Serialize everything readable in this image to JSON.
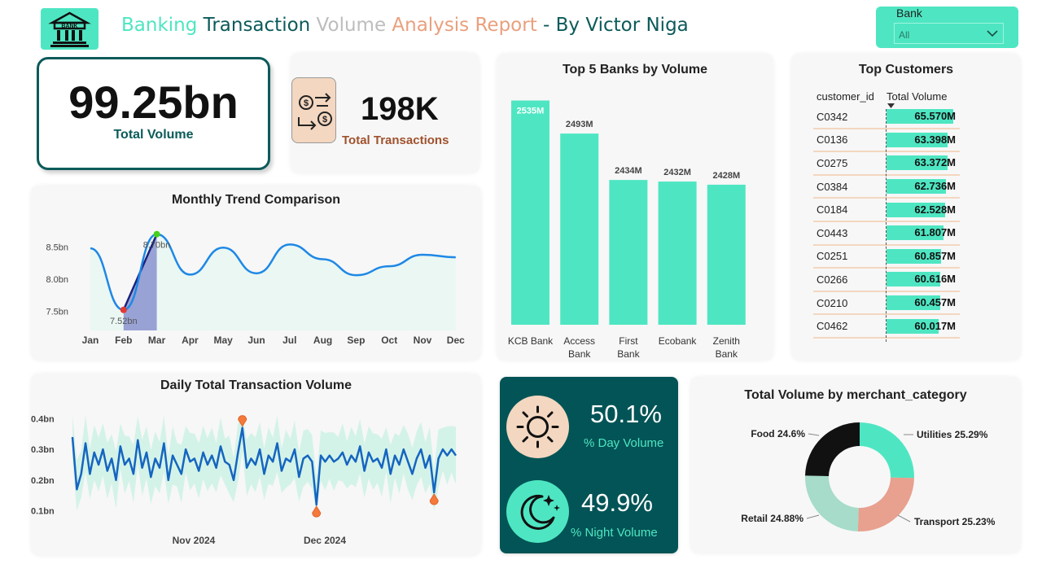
{
  "header": {
    "title_parts": [
      "Banking",
      "Transaction",
      "Volume",
      "Analysis Report",
      "- By Victor Niga"
    ],
    "title_colors": [
      "#4ee6c2",
      "#0c5a5a",
      "#bdbdbd",
      "#e9a07d",
      "#0c5a5a"
    ],
    "logo_text": "BANK"
  },
  "slicer": {
    "label": "Bank",
    "value": "All"
  },
  "kpi": {
    "total_volume": "99.25bn",
    "total_volume_label": "Total Volume",
    "total_transactions": "198K",
    "total_transactions_label": "Total Transactions"
  },
  "monthly": {
    "title": "Monthly Trend Comparison",
    "y_ticks": [
      "8.5bn",
      "8.0bn",
      "7.5bn"
    ],
    "low_label": "7.52bn",
    "high_label": "8.70bn"
  },
  "top5": {
    "title": "Top 5 Banks by Volume"
  },
  "top_customers": {
    "title": "Top Customers",
    "col1": "customer_id",
    "col2": "Total Volume",
    "rows": [
      {
        "id": "C0342",
        "value": "65.570M"
      },
      {
        "id": "C0136",
        "value": "63.398M"
      },
      {
        "id": "C0275",
        "value": "63.372M"
      },
      {
        "id": "C0384",
        "value": "62.736M"
      },
      {
        "id": "C0184",
        "value": "62.528M"
      },
      {
        "id": "C0443",
        "value": "61.807M"
      },
      {
        "id": "C0251",
        "value": "60.857M"
      },
      {
        "id": "C0266",
        "value": "60.616M"
      },
      {
        "id": "C0210",
        "value": "60.457M"
      },
      {
        "id": "C0462",
        "value": "60.017M"
      }
    ]
  },
  "daily": {
    "title": "Daily Total Transaction Volume",
    "y_ticks": [
      "0.4bn",
      "0.3bn",
      "0.2bn",
      "0.1bn"
    ],
    "x_ticks": [
      "Nov 2024",
      "Dec 2024"
    ]
  },
  "day_night": {
    "day_value": "50.1%",
    "day_label": "% Day Volume",
    "night_value": "49.9%",
    "night_label": "% Night Volume"
  },
  "merchant": {
    "title": "Total Volume by merchant_category"
  },
  "colors": {
    "accent": "#4ee6c2",
    "teal_dark": "#035456",
    "peach": "#f3d7c0",
    "salmon": "#e8a08f",
    "mint": "#a6dcc9",
    "line_blue": "#1e88e5"
  },
  "chart_data": [
    {
      "type": "line",
      "title": "Monthly Trend Comparison",
      "categories": [
        "Jan",
        "Feb",
        "Mar",
        "Apr",
        "May",
        "Jun",
        "Jul",
        "Aug",
        "Sep",
        "Oct",
        "Nov",
        "Dec"
      ],
      "values": [
        8.48,
        7.52,
        8.7,
        8.07,
        8.49,
        8.09,
        8.54,
        8.31,
        8.06,
        8.2,
        8.38,
        8.34
      ],
      "yunit": "bn",
      "ylim": [
        7.2,
        8.95
      ],
      "annotations": [
        "7.52bn",
        "8.70bn"
      ]
    },
    {
      "type": "bar",
      "title": "Top 5 Banks by Volume",
      "categories": [
        "KCB Bank",
        "Access Bank",
        "First Bank",
        "Ecobank",
        "Zenith Bank"
      ],
      "values": [
        2535,
        2493,
        2434,
        2432,
        2428
      ],
      "labels": [
        "2535M",
        "2493M",
        "2434M",
        "2432M",
        "2428M"
      ],
      "ylim": [
        2250,
        2550
      ]
    },
    {
      "type": "table",
      "title": "Top Customers",
      "columns": [
        "customer_id",
        "Total Volume"
      ],
      "values": [
        65.57,
        63.398,
        63.372,
        62.736,
        62.528,
        61.807,
        60.857,
        60.616,
        60.457,
        60.017
      ]
    },
    {
      "type": "line",
      "title": "Daily Total Transaction Volume",
      "x_ticks": [
        "Nov 2024",
        "Dec 2024"
      ],
      "yunit": "bn",
      "ylim": [
        0.07,
        0.43
      ],
      "values": [
        0.34,
        0.17,
        0.22,
        0.32,
        0.22,
        0.29,
        0.25,
        0.3,
        0.23,
        0.27,
        0.2,
        0.31,
        0.25,
        0.27,
        0.22,
        0.33,
        0.24,
        0.29,
        0.21,
        0.27,
        0.24,
        0.32,
        0.2,
        0.28,
        0.25,
        0.22,
        0.3,
        0.26,
        0.27,
        0.23,
        0.29,
        0.25,
        0.28,
        0.24,
        0.31,
        0.26,
        0.25,
        0.2,
        0.29,
        0.37,
        0.24,
        0.27,
        0.25,
        0.3,
        0.22,
        0.28,
        0.26,
        0.32,
        0.23,
        0.27,
        0.26,
        0.3,
        0.21,
        0.27,
        0.28,
        0.26,
        0.12,
        0.28,
        0.26,
        0.28,
        0.26,
        0.27,
        0.29,
        0.25,
        0.28,
        0.26,
        0.31,
        0.23,
        0.29,
        0.26,
        0.27,
        0.24,
        0.3,
        0.22,
        0.28,
        0.25,
        0.3,
        0.26,
        0.22,
        0.27,
        0.3,
        0.24,
        0.28,
        0.16,
        0.27,
        0.3,
        0.28,
        0.3,
        0.28
      ],
      "markers": [
        {
          "index": 39,
          "value": 0.37
        },
        {
          "index": 56,
          "value": 0.12
        },
        {
          "index": 83,
          "value": 0.16
        }
      ]
    },
    {
      "type": "pie",
      "title": "Total Volume by merchant_category",
      "categories": [
        "Utilities",
        "Transport",
        "Retail",
        "Food"
      ],
      "values": [
        25.29,
        25.23,
        24.88,
        24.6
      ],
      "labels": [
        "Utilities 25.29%",
        "Transport 25.23%",
        "Retail 24.88%",
        "Food 24.6%"
      ],
      "colors": [
        "#4ee6c2",
        "#e8a08f",
        "#a6dcc9",
        "#111111"
      ]
    }
  ]
}
